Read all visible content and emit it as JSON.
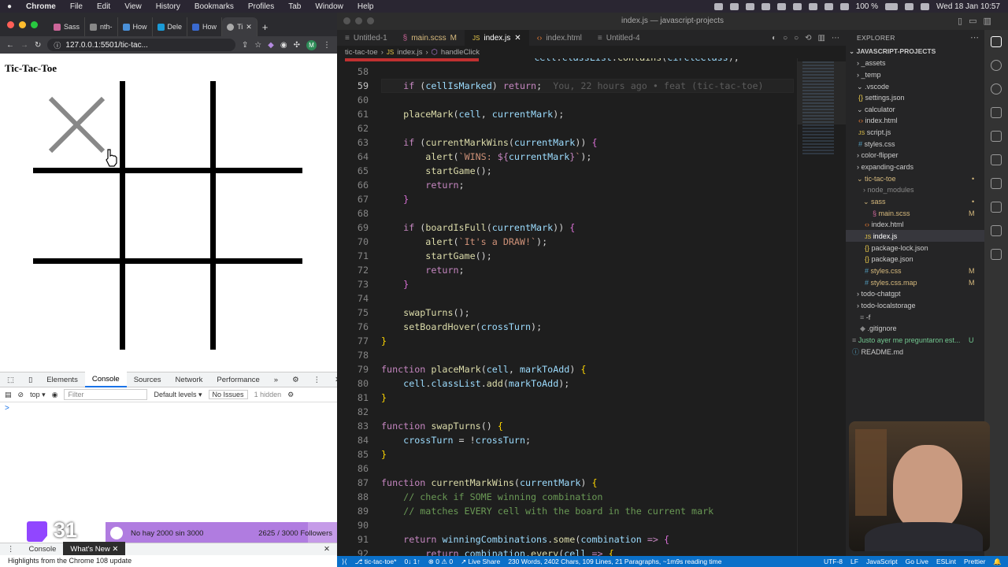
{
  "menubar": {
    "items": [
      "Chrome",
      "File",
      "Edit",
      "View",
      "History",
      "Bookmarks",
      "Profiles",
      "Tab",
      "Window",
      "Help"
    ],
    "battery": "100 %",
    "clock": "Wed 18 Jan  10:57"
  },
  "chrome": {
    "tabs": [
      "Sass",
      "nth-",
      "How",
      "Dele",
      "How",
      "Ti"
    ],
    "address": "127.0.0.1:5501/tic-tac...",
    "page_title": "Tic-Tac-Toe",
    "devtools_tabs": [
      "Elements",
      "Console",
      "Sources",
      "Network",
      "Performance"
    ],
    "active_devtools_tab": "Console",
    "console_context": "top",
    "filter_placeholder": "Filter",
    "levels": "Default levels",
    "issues": "No Issues",
    "hidden": "1 hidden",
    "prompt": ">",
    "drawer_tabs": [
      "Console",
      "What's New"
    ],
    "highlights": "Highlights from the Chrome 108 update"
  },
  "overlay": {
    "count": "31",
    "goal_text": "No hay 2000 sin 3000",
    "followers_current": "2625",
    "followers_goal": "/ 3000 Followers",
    "followers_progress": 0.875
  },
  "vscode": {
    "title": "index.js — javascript-projects",
    "tabs": [
      {
        "label": "Untitled-1",
        "flag": ""
      },
      {
        "label": "main.scss",
        "flag": "M"
      },
      {
        "label": "index.js",
        "flag": ""
      },
      {
        "label": "index.html",
        "flag": ""
      },
      {
        "label": "Untitled-4",
        "flag": ""
      }
    ],
    "breadcrumb": [
      "tic-tac-toe",
      "index.js",
      "handleClick"
    ],
    "blame": "You, 22 hours ago • feat (tic-tac-toe)",
    "explorer_title": "EXPLORER",
    "project": "JAVASCRIPT-PROJECTS",
    "files": [
      {
        "name": "_assets",
        "depth": 1,
        "badge": ""
      },
      {
        "name": "_temp",
        "depth": 1,
        "badge": ""
      },
      {
        "name": ".vscode",
        "depth": 1,
        "badge": ""
      },
      {
        "name": "settings.json",
        "depth": 2,
        "badge": ""
      },
      {
        "name": "calculator",
        "depth": 1,
        "badge": ""
      },
      {
        "name": "index.html",
        "depth": 2,
        "badge": ""
      },
      {
        "name": "script.js",
        "depth": 2,
        "badge": ""
      },
      {
        "name": "styles.css",
        "depth": 2,
        "badge": ""
      },
      {
        "name": "color-flipper",
        "depth": 1,
        "badge": ""
      },
      {
        "name": "expanding-cards",
        "depth": 1,
        "badge": ""
      },
      {
        "name": "tic-tac-toe",
        "depth": 1,
        "badge": "•"
      },
      {
        "name": "node_modules",
        "depth": 2,
        "badge": ""
      },
      {
        "name": "sass",
        "depth": 2,
        "badge": "•"
      },
      {
        "name": "main.scss",
        "depth": 3,
        "badge": "M"
      },
      {
        "name": "index.html",
        "depth": 2,
        "badge": ""
      },
      {
        "name": "index.js",
        "depth": 2,
        "badge": ""
      },
      {
        "name": "package-lock.json",
        "depth": 2,
        "badge": ""
      },
      {
        "name": "package.json",
        "depth": 2,
        "badge": ""
      },
      {
        "name": "styles.css",
        "depth": 2,
        "badge": "M"
      },
      {
        "name": "styles.css.map",
        "depth": 2,
        "badge": "M"
      },
      {
        "name": "todo-chatgpt",
        "depth": 1,
        "badge": ""
      },
      {
        "name": "todo-localstorage",
        "depth": 1,
        "badge": ""
      },
      {
        "name": "-f",
        "depth": 1,
        "badge": ""
      },
      {
        "name": ".gitignore",
        "depth": 1,
        "badge": ""
      },
      {
        "name": "Justo ayer me preguntaron est...",
        "depth": 1,
        "badge": "U"
      },
      {
        "name": "README.md",
        "depth": 1,
        "badge": ""
      }
    ],
    "status": {
      "branch": "tic-tac-toe*",
      "sync": "0↓ 1↑",
      "problems": "⊗ 0 ⚠ 0",
      "liveshare": "Live Share",
      "stats": "230 Words, 2402 Chars, 109 Lines, 21 Paragraphs, ~1m9s reading time",
      "right": [
        "UTF-8",
        "LF",
        "JavaScript",
        "Go Live",
        "ESLint",
        "Prettier"
      ]
    }
  }
}
